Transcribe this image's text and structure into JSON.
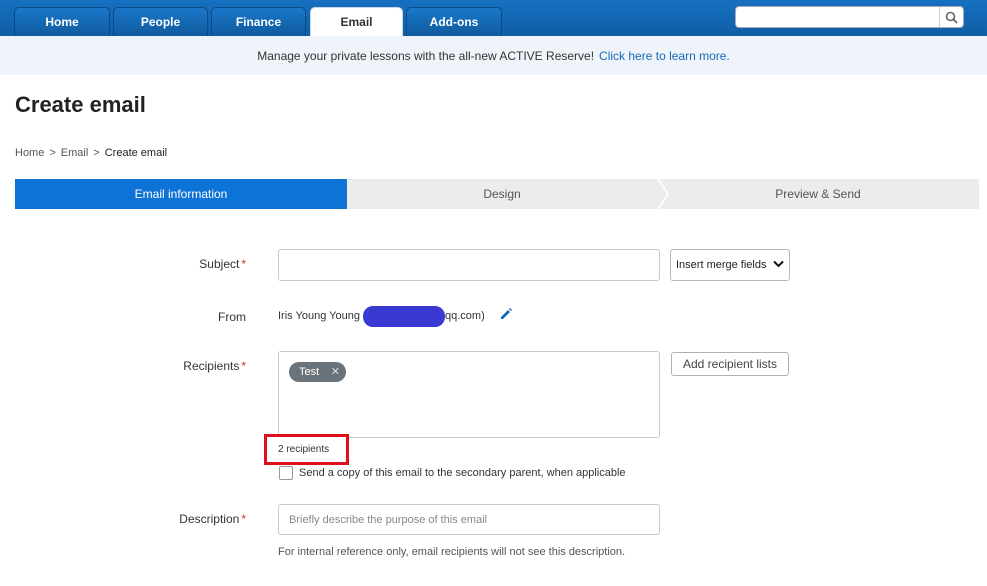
{
  "nav": {
    "tabs": [
      "Home",
      "People",
      "Finance",
      "Email",
      "Add-ons"
    ],
    "active": "Email",
    "search_placeholder": ""
  },
  "banner": {
    "text": "Manage your private lessons with the all-new ACTIVE Reserve!",
    "link": "Click here to learn more."
  },
  "page": {
    "title": "Create email"
  },
  "breadcrumb": {
    "home": "Home",
    "sep": ">",
    "email": "Email",
    "current": "Create email"
  },
  "steps": [
    "Email information",
    "Design",
    "Preview & Send"
  ],
  "form": {
    "subject_label": "Subject",
    "subject_value": "",
    "merge_select": "Insert merge fields",
    "from_label": "From",
    "from_prefix": "Iris Young Young",
    "from_suffix": "qq.com)",
    "recipients_label": "Recipients",
    "recipient_chip": "Test",
    "add_lists_button": "Add recipient lists",
    "recipient_count": "2 recipients",
    "secondary_parent_label": "Send a copy of this email to the secondary parent, when applicable",
    "description_label": "Description",
    "description_placeholder": "Briefly describe the purpose of this email",
    "description_hint": "For internal reference only, email recipients will not see this description.",
    "required_mark": "*"
  },
  "colors": {
    "nav": "#1670c0",
    "accent": "#0e73d6",
    "highlight": "#e0101c",
    "redaction": "#3a3ad3"
  }
}
